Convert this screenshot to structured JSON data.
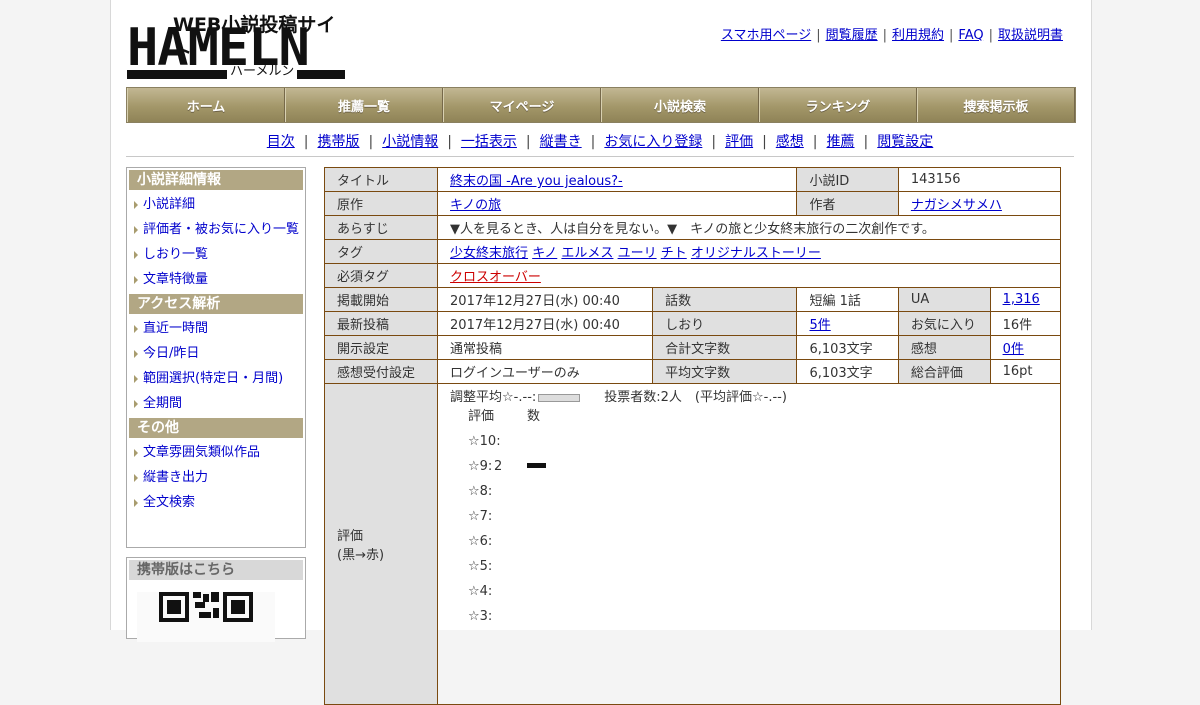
{
  "logo": {
    "tag": "WEB小説投稿サイト",
    "main": "HAMELN",
    "kana": "ハーメルン"
  },
  "toplinks": [
    "スマホ用ページ",
    "閲覧履歴",
    "利用規約",
    "FAQ",
    "取扱説明書"
  ],
  "gnav": [
    "ホーム",
    "推薦一覧",
    "マイページ",
    "小説検索",
    "ランキング",
    "捜索掲示板"
  ],
  "snav": [
    "目次",
    "携帯版",
    "小説情報",
    "一括表示",
    "縦書き",
    "お気に入り登録",
    "評価",
    "感想",
    "推薦",
    "閲覧設定"
  ],
  "side": {
    "h1": "小説詳細情報",
    "g1": [
      "小説詳細",
      "評価者・被お気に入り一覧",
      "しおり一覧",
      "文章特徴量"
    ],
    "h2": "アクセス解析",
    "g2": [
      "直近一時間",
      "今日/昨日",
      "範囲選択(特定日・月間)",
      "全期間"
    ],
    "h3": "その他",
    "g3": [
      "文章雰囲気類似作品",
      "縦書き出力",
      "全文検索"
    ]
  },
  "mobile": {
    "title": "携帯版はこちら"
  },
  "info": {
    "title_label": "タイトル",
    "title": "終末の国 -Are you jealous?-",
    "id_label": "小説ID",
    "id": "143156",
    "origin_label": "原作",
    "origin": "キノの旅",
    "author_label": "作者",
    "author": "ナガシメサメハ",
    "summary_label": "あらすじ",
    "summary": "▼人を見るとき、人は自分を見ない。▼　キノの旅と少女終末旅行の二次創作です。",
    "tags_label": "タグ",
    "tags": [
      "少女終末旅行",
      "キノ",
      "エルメス",
      "ユーリ",
      "チト",
      "オリジナルストーリー"
    ],
    "req_label": "必須タグ",
    "req": "クロスオーバー",
    "start_label": "掲載開始",
    "start": "2017年12月27日(水) 00:40",
    "eps_label": "話数",
    "eps": "短編 1話",
    "ua_label": "UA",
    "ua": "1,316",
    "latest_label": "最新投稿",
    "latest": "2017年12月27日(水) 00:40",
    "bm_label": "しおり",
    "bm": "5件",
    "fav_label": "お気に入り",
    "fav": "16件",
    "open_label": "開示設定",
    "open": "通常投稿",
    "total_label": "合計文字数",
    "total": "6,103文字",
    "impr_label": "感想",
    "impr": "0件",
    "recv_label": "感想受付設定",
    "recv": "ログインユーザーのみ",
    "avg_label": "平均文字数",
    "avg": "6,103文字",
    "score_label": "総合評価",
    "score": "16pt",
    "rating_label": "評価",
    "rating_sub": "(黒→赤)"
  },
  "rating": {
    "summary_a": "調整平均☆-.--:",
    "summary_b": "投票者数:2人　(平均評価☆-.--)",
    "col_label": "評価",
    "col_count": "数",
    "rows": [
      {
        "label": "☆10:",
        "count": "",
        "value": 0
      },
      {
        "label": "☆9:",
        "count": "2",
        "value": 2
      },
      {
        "label": "☆8:",
        "count": "",
        "value": 0
      },
      {
        "label": "☆7:",
        "count": "",
        "value": 0
      },
      {
        "label": "☆6:",
        "count": "",
        "value": 0
      },
      {
        "label": "☆5:",
        "count": "",
        "value": 0
      },
      {
        "label": "☆4:",
        "count": "",
        "value": 0
      },
      {
        "label": "☆3:",
        "count": "",
        "value": 0
      }
    ],
    "bar_color": "#111111"
  },
  "colors": {
    "nav_bg": "#a39769",
    "side_header": "#b2a784",
    "table_border": "#7a4a10",
    "link": "#0000cc",
    "required_tag": "#cc0000"
  }
}
